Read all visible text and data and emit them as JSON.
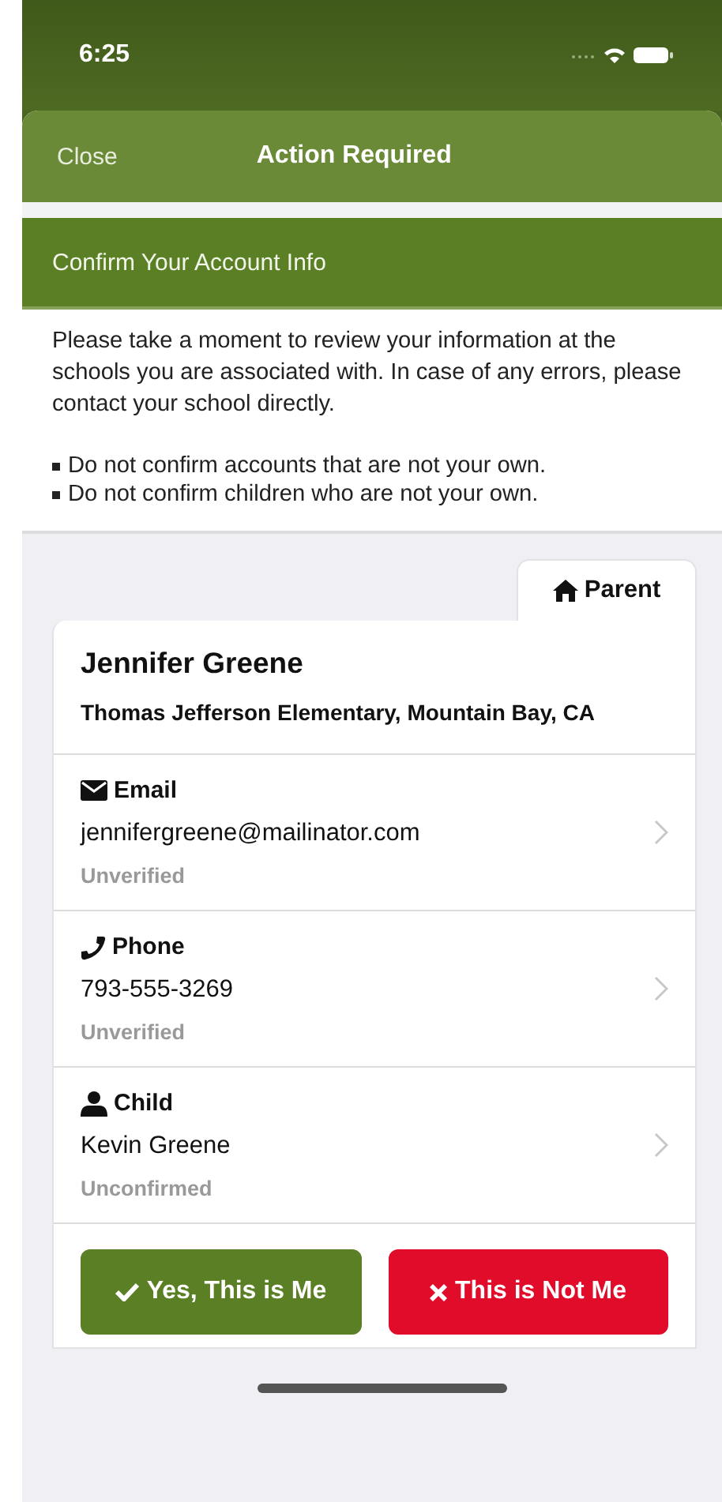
{
  "status_bar": {
    "time": "6:25"
  },
  "header": {
    "close": "Close",
    "title": "Action Required"
  },
  "banner": {
    "title": "Confirm Your Account Info"
  },
  "intro": "Please take a moment to review your information at the schools you are associated with. In case of any errors, please contact your school directly.",
  "rules": [
    "Do not confirm accounts that are not your own.",
    "Do not confirm children who are not your own."
  ],
  "tab": {
    "label": "Parent"
  },
  "person": {
    "name": "Jennifer Greene",
    "school": "Thomas Jefferson Elementary, Mountain Bay, CA"
  },
  "items": [
    {
      "kind": "email",
      "label": "Email",
      "value": "jennifergreene@mailinator.com",
      "status": "Unverified"
    },
    {
      "kind": "phone",
      "label": "Phone",
      "value": "793-555-3269",
      "status": "Unverified"
    },
    {
      "kind": "child",
      "label": "Child",
      "value": "Kevin Greene",
      "status": "Unconfirmed"
    }
  ],
  "buttons": [
    {
      "kind": "confirm",
      "label": "Yes, This is Me"
    },
    {
      "kind": "reject",
      "label": "This is Not Me"
    }
  ]
}
